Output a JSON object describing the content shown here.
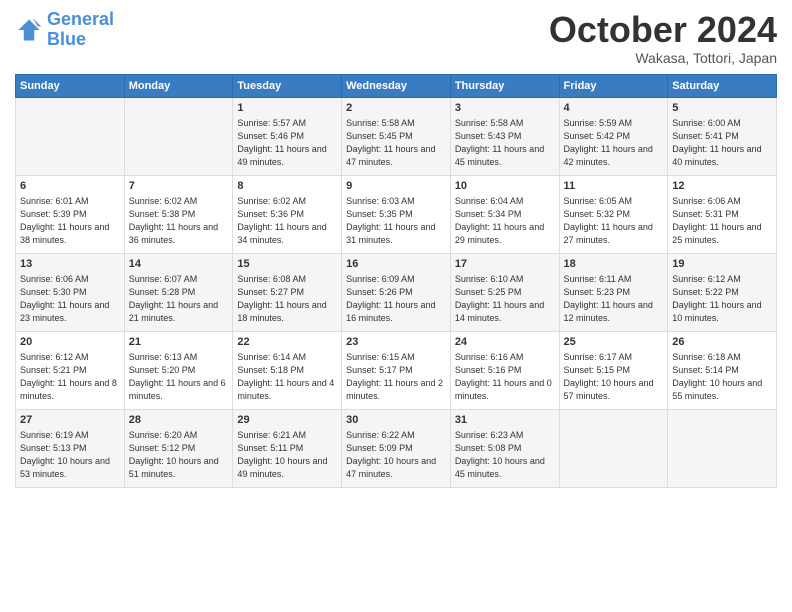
{
  "header": {
    "logo_general": "General",
    "logo_blue": "Blue",
    "month": "October 2024",
    "location": "Wakasa, Tottori, Japan"
  },
  "weekdays": [
    "Sunday",
    "Monday",
    "Tuesday",
    "Wednesday",
    "Thursday",
    "Friday",
    "Saturday"
  ],
  "weeks": [
    [
      {
        "day": "",
        "info": ""
      },
      {
        "day": "",
        "info": ""
      },
      {
        "day": "1",
        "info": "Sunrise: 5:57 AM\nSunset: 5:46 PM\nDaylight: 11 hours and 49 minutes."
      },
      {
        "day": "2",
        "info": "Sunrise: 5:58 AM\nSunset: 5:45 PM\nDaylight: 11 hours and 47 minutes."
      },
      {
        "day": "3",
        "info": "Sunrise: 5:58 AM\nSunset: 5:43 PM\nDaylight: 11 hours and 45 minutes."
      },
      {
        "day": "4",
        "info": "Sunrise: 5:59 AM\nSunset: 5:42 PM\nDaylight: 11 hours and 42 minutes."
      },
      {
        "day": "5",
        "info": "Sunrise: 6:00 AM\nSunset: 5:41 PM\nDaylight: 11 hours and 40 minutes."
      }
    ],
    [
      {
        "day": "6",
        "info": "Sunrise: 6:01 AM\nSunset: 5:39 PM\nDaylight: 11 hours and 38 minutes."
      },
      {
        "day": "7",
        "info": "Sunrise: 6:02 AM\nSunset: 5:38 PM\nDaylight: 11 hours and 36 minutes."
      },
      {
        "day": "8",
        "info": "Sunrise: 6:02 AM\nSunset: 5:36 PM\nDaylight: 11 hours and 34 minutes."
      },
      {
        "day": "9",
        "info": "Sunrise: 6:03 AM\nSunset: 5:35 PM\nDaylight: 11 hours and 31 minutes."
      },
      {
        "day": "10",
        "info": "Sunrise: 6:04 AM\nSunset: 5:34 PM\nDaylight: 11 hours and 29 minutes."
      },
      {
        "day": "11",
        "info": "Sunrise: 6:05 AM\nSunset: 5:32 PM\nDaylight: 11 hours and 27 minutes."
      },
      {
        "day": "12",
        "info": "Sunrise: 6:06 AM\nSunset: 5:31 PM\nDaylight: 11 hours and 25 minutes."
      }
    ],
    [
      {
        "day": "13",
        "info": "Sunrise: 6:06 AM\nSunset: 5:30 PM\nDaylight: 11 hours and 23 minutes."
      },
      {
        "day": "14",
        "info": "Sunrise: 6:07 AM\nSunset: 5:28 PM\nDaylight: 11 hours and 21 minutes."
      },
      {
        "day": "15",
        "info": "Sunrise: 6:08 AM\nSunset: 5:27 PM\nDaylight: 11 hours and 18 minutes."
      },
      {
        "day": "16",
        "info": "Sunrise: 6:09 AM\nSunset: 5:26 PM\nDaylight: 11 hours and 16 minutes."
      },
      {
        "day": "17",
        "info": "Sunrise: 6:10 AM\nSunset: 5:25 PM\nDaylight: 11 hours and 14 minutes."
      },
      {
        "day": "18",
        "info": "Sunrise: 6:11 AM\nSunset: 5:23 PM\nDaylight: 11 hours and 12 minutes."
      },
      {
        "day": "19",
        "info": "Sunrise: 6:12 AM\nSunset: 5:22 PM\nDaylight: 11 hours and 10 minutes."
      }
    ],
    [
      {
        "day": "20",
        "info": "Sunrise: 6:12 AM\nSunset: 5:21 PM\nDaylight: 11 hours and 8 minutes."
      },
      {
        "day": "21",
        "info": "Sunrise: 6:13 AM\nSunset: 5:20 PM\nDaylight: 11 hours and 6 minutes."
      },
      {
        "day": "22",
        "info": "Sunrise: 6:14 AM\nSunset: 5:18 PM\nDaylight: 11 hours and 4 minutes."
      },
      {
        "day": "23",
        "info": "Sunrise: 6:15 AM\nSunset: 5:17 PM\nDaylight: 11 hours and 2 minutes."
      },
      {
        "day": "24",
        "info": "Sunrise: 6:16 AM\nSunset: 5:16 PM\nDaylight: 11 hours and 0 minutes."
      },
      {
        "day": "25",
        "info": "Sunrise: 6:17 AM\nSunset: 5:15 PM\nDaylight: 10 hours and 57 minutes."
      },
      {
        "day": "26",
        "info": "Sunrise: 6:18 AM\nSunset: 5:14 PM\nDaylight: 10 hours and 55 minutes."
      }
    ],
    [
      {
        "day": "27",
        "info": "Sunrise: 6:19 AM\nSunset: 5:13 PM\nDaylight: 10 hours and 53 minutes."
      },
      {
        "day": "28",
        "info": "Sunrise: 6:20 AM\nSunset: 5:12 PM\nDaylight: 10 hours and 51 minutes."
      },
      {
        "day": "29",
        "info": "Sunrise: 6:21 AM\nSunset: 5:11 PM\nDaylight: 10 hours and 49 minutes."
      },
      {
        "day": "30",
        "info": "Sunrise: 6:22 AM\nSunset: 5:09 PM\nDaylight: 10 hours and 47 minutes."
      },
      {
        "day": "31",
        "info": "Sunrise: 6:23 AM\nSunset: 5:08 PM\nDaylight: 10 hours and 45 minutes."
      },
      {
        "day": "",
        "info": ""
      },
      {
        "day": "",
        "info": ""
      }
    ]
  ]
}
